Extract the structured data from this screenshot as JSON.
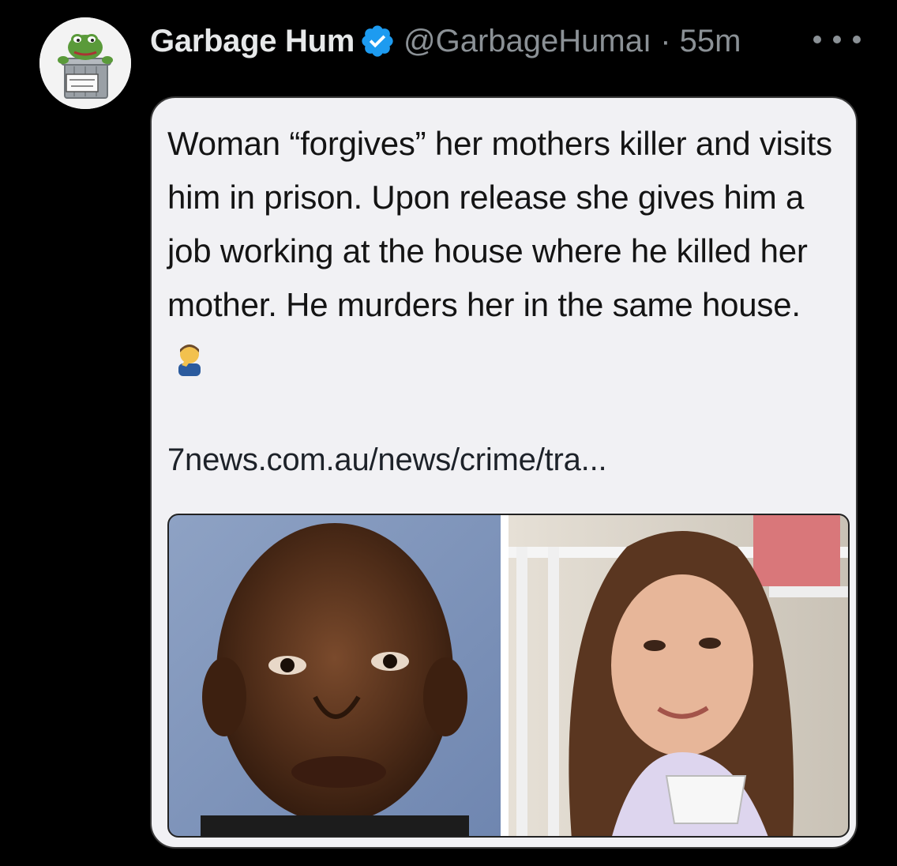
{
  "tweet": {
    "author": {
      "display_name": "Garbage Hum",
      "handle": "@GarbageHumaı",
      "separator": "·",
      "time": "55m",
      "avatar_text": "GARBAGE HUMAN"
    },
    "more_icon": "more-horizontal-icon"
  },
  "card": {
    "text": "Woman “forgives” her mothers killer and visits him in prison. Upon release she gives him a job working at the house where he killed her mother. He murders her in the same house.",
    "emoji": "facepalm-emoji",
    "link": "7news.com.au/news/crime/tra..."
  },
  "colors": {
    "background": "#000000",
    "text_primary": "#e7e9ea",
    "text_secondary": "#8b9196",
    "verified_blue": "#1d9bf0",
    "card_background": "#f1f1f4"
  }
}
